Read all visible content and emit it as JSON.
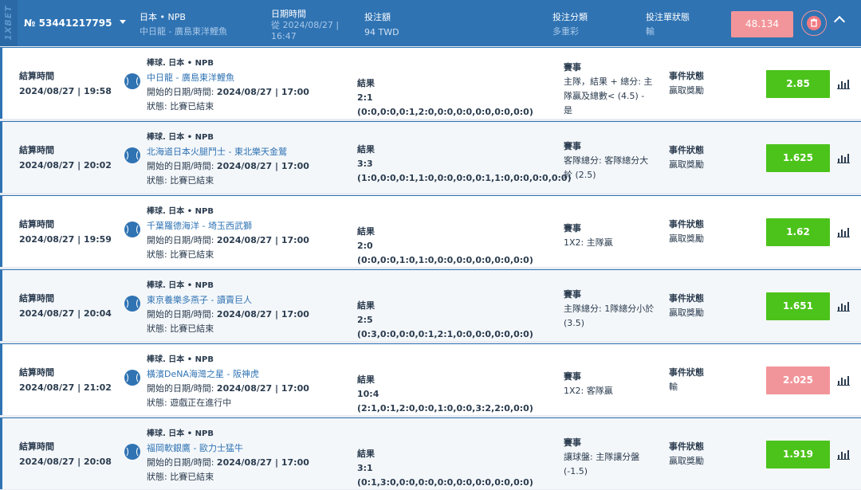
{
  "header": {
    "brand": "1XBET",
    "coupon_no": "№ 53441217795",
    "match_label": "日本 • NPB",
    "match_teams": "中日龍 - 廣島東洋鯉魚",
    "datetime_label": "日期時間",
    "datetime_value": "從 2024/08/27 | 16:47",
    "stake_label": "投注額",
    "stake_value": "94 TWD",
    "bet_type_label": "投注分類",
    "bet_type_value": "多重彩",
    "status_label": "投注單狀態",
    "status_value": "輸",
    "total_odds": "48.134",
    "colors": {
      "header_bg": "#2f73b3",
      "loss": "#f2959a",
      "win": "#4cc31b"
    }
  },
  "labels": {
    "settle": "結算時間",
    "result": "結果",
    "event": "賽事",
    "event_status": "事件狀態"
  },
  "rows": [
    {
      "settle": "2024/08/27 | 19:58",
      "league": "棒球. 日本 • NPB",
      "teams": "中日龍 - 廣島東洋鯉魚",
      "start_label": "開始的日期/時間: ",
      "start_value": "2024/08/27 | 17:00",
      "status": "狀態: 比賽已結束",
      "result": "2:1 (0:0,0:0,0:1,2:0,0:0,0:0,0:0,0:0,0:0)",
      "event": "主隊，結果 + 總分: 主隊贏及總數< (4.5) - 是",
      "event_status": "贏取獎勵",
      "odds": "2.85",
      "state": "win"
    },
    {
      "settle": "2024/08/27 | 20:02",
      "league": "棒球. 日本 • NPB",
      "teams": "北海道日本火腿鬥士 - 東北樂天金鷲",
      "start_label": "開始的日期/時間: ",
      "start_value": "2024/08/27 | 17:00",
      "status": "狀態: 比賽已結束",
      "result": "3:3 (1:0,0:0,0:1,1:0,0:0,0:0,0:1,1:0,0:0,0:0,0:0)",
      "event": "客隊總分: 客隊總分大於 (2.5)",
      "event_status": "贏取獎勵",
      "odds": "1.625",
      "state": "win"
    },
    {
      "settle": "2024/08/27 | 19:59",
      "league": "棒球. 日本 • NPB",
      "teams": "千葉羅德海洋 - 埼玉西武獅",
      "start_label": "開始的日期/時間: ",
      "start_value": "2024/08/27 | 17:00",
      "status": "狀態: 比賽已結束",
      "result": "2:0 (0:0,0:0,1:0,1:0,0:0,0:0,0:0,0:0,0:0)",
      "event": "1X2: 主隊贏",
      "event_status": "贏取獎勵",
      "odds": "1.62",
      "state": "win"
    },
    {
      "settle": "2024/08/27 | 20:04",
      "league": "棒球. 日本 • NPB",
      "teams": "東京養樂多燕子 - 讀賣巨人",
      "start_label": "開始的日期/時間: ",
      "start_value": "2024/08/27 | 17:00",
      "status": "狀態: 比賽已結束",
      "result": "2:5 (0:3,0:0,0:0,0:1,2:1,0:0,0:0,0:0,0:0)",
      "event": "主隊總分: 1隊總分小於 (3.5)",
      "event_status": "贏取獎勵",
      "odds": "1.651",
      "state": "win"
    },
    {
      "settle": "2024/08/27 | 21:02",
      "league": "棒球. 日本 • NPB",
      "teams": "橫濱DeNA海灣之星 - 阪神虎",
      "start_label": "開始的日期/時間: ",
      "start_value": "2024/08/27 | 17:00",
      "status": "狀態: 遊戲正在進行中",
      "result": "10:4 (2:1,0:1,2:0,0:0,1:0,0:0,3:2,2:0,0:0)",
      "event": "1X2: 客隊贏",
      "event_status": "輸",
      "odds": "2.025",
      "state": "loss"
    },
    {
      "settle": "2024/08/27 | 20:08",
      "league": "棒球. 日本 • NPB",
      "teams": "福岡軟銀鷹 - 歐力士猛牛",
      "start_label": "開始的日期/時間: ",
      "start_value": "2024/08/27 | 17:00",
      "status": "狀態: 比賽已結束",
      "result": "3:1 (0:1,3:0,0:0,0:0,0:0,0:0,0:0,0:0,0:0)",
      "event": "讓球盤: 主隊讓分盤 (-1.5)",
      "event_status": "贏取獎勵",
      "odds": "1.919",
      "state": "win"
    }
  ]
}
